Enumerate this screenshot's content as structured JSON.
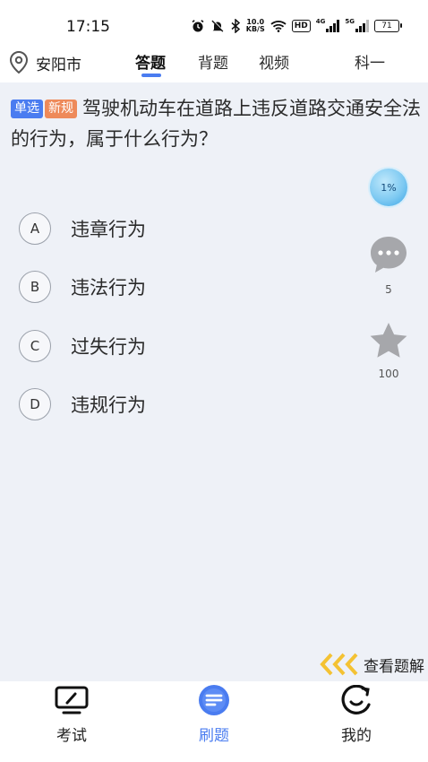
{
  "status_bar": {
    "time": "17:15",
    "network_speed_value": "10.0",
    "network_speed_unit": "KB/S",
    "hd_label": "HD",
    "signal1_label": "4G",
    "signal2_label": "5G",
    "battery": "71"
  },
  "header": {
    "city": "安阳市",
    "tabs": [
      {
        "label": "答题",
        "active": true
      },
      {
        "label": "背题",
        "active": false
      },
      {
        "label": "视频",
        "active": false
      },
      {
        "label": "科一",
        "active": false
      }
    ],
    "accent_color": "#4a7cf0"
  },
  "question": {
    "type_badge": "单选",
    "rule_badge": "新规",
    "text": "驾驶机动车在道路上违反道路交通安全法的行为，属于什么行为？",
    "options": [
      {
        "letter": "A",
        "text": "违章行为"
      },
      {
        "letter": "B",
        "text": "违法行为"
      },
      {
        "letter": "C",
        "text": "过失行为"
      },
      {
        "letter": "D",
        "text": "违规行为"
      }
    ]
  },
  "side_panel": {
    "progress": "1%",
    "comment_count": "5",
    "favorite_count": "100"
  },
  "solution_link": "查看题解",
  "bottom_nav": [
    {
      "label": "考试",
      "icon": "monitor-pen-icon",
      "active": false
    },
    {
      "label": "刷题",
      "icon": "practice-doc-icon",
      "active": true
    },
    {
      "label": "我的",
      "icon": "smile-face-icon",
      "active": false
    }
  ]
}
